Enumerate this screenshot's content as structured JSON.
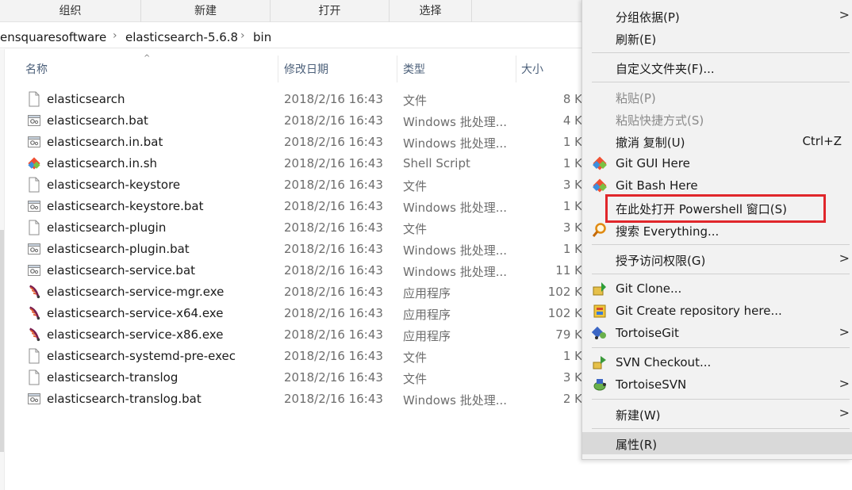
{
  "ribbon": {
    "groups": [
      "组织",
      "新建",
      "打开",
      "选择"
    ]
  },
  "address": {
    "crumbs": [
      "ensquaresoftware",
      "elasticsearch-5.6.8",
      "bin"
    ]
  },
  "columns": {
    "name": "名称",
    "date": "修改日期",
    "type": "类型",
    "size": "大小"
  },
  "files": [
    {
      "name": "elasticsearch",
      "date": "2018/2/16 16:43",
      "type": "文件",
      "size": "8 K",
      "icon": "file-icon"
    },
    {
      "name": "elasticsearch.bat",
      "date": "2018/2/16 16:43",
      "type": "Windows 批处理...",
      "size": "4 K",
      "icon": "batch-file-icon"
    },
    {
      "name": "elasticsearch.in.bat",
      "date": "2018/2/16 16:43",
      "type": "Windows 批处理...",
      "size": "1 K",
      "icon": "batch-file-icon"
    },
    {
      "name": "elasticsearch.in.sh",
      "date": "2018/2/16 16:43",
      "type": "Shell Script",
      "size": "1 K",
      "icon": "git-shell-icon"
    },
    {
      "name": "elasticsearch-keystore",
      "date": "2018/2/16 16:43",
      "type": "文件",
      "size": "3 K",
      "icon": "file-icon"
    },
    {
      "name": "elasticsearch-keystore.bat",
      "date": "2018/2/16 16:43",
      "type": "Windows 批处理...",
      "size": "1 K",
      "icon": "batch-file-icon"
    },
    {
      "name": "elasticsearch-plugin",
      "date": "2018/2/16 16:43",
      "type": "文件",
      "size": "3 K",
      "icon": "file-icon"
    },
    {
      "name": "elasticsearch-plugin.bat",
      "date": "2018/2/16 16:43",
      "type": "Windows 批处理...",
      "size": "1 K",
      "icon": "batch-file-icon"
    },
    {
      "name": "elasticsearch-service.bat",
      "date": "2018/2/16 16:43",
      "type": "Windows 批处理...",
      "size": "11 K",
      "icon": "batch-file-icon"
    },
    {
      "name": "elasticsearch-service-mgr.exe",
      "date": "2018/2/16 16:43",
      "type": "应用程序",
      "size": "102 K",
      "icon": "exe-feather-icon"
    },
    {
      "name": "elasticsearch-service-x64.exe",
      "date": "2018/2/16 16:43",
      "type": "应用程序",
      "size": "102 K",
      "icon": "exe-feather-icon"
    },
    {
      "name": "elasticsearch-service-x86.exe",
      "date": "2018/2/16 16:43",
      "type": "应用程序",
      "size": "79 K",
      "icon": "exe-feather-icon"
    },
    {
      "name": "elasticsearch-systemd-pre-exec",
      "date": "2018/2/16 16:43",
      "type": "文件",
      "size": "1 K",
      "icon": "file-icon"
    },
    {
      "name": "elasticsearch-translog",
      "date": "2018/2/16 16:43",
      "type": "文件",
      "size": "3 K",
      "icon": "file-icon"
    },
    {
      "name": "elasticsearch-translog.bat",
      "date": "2018/2/16 16:43",
      "type": "Windows 批处理...",
      "size": "2 K",
      "icon": "batch-file-icon"
    }
  ],
  "menu": {
    "items": [
      {
        "label": "分组依据(P)",
        "submenu": true
      },
      {
        "label": "刷新(E)"
      },
      {
        "label": "自定义文件夹(F)..."
      },
      {
        "label": "粘贴(P)",
        "disabled": true
      },
      {
        "label": "粘贴快捷方式(S)",
        "disabled": true
      },
      {
        "label": "撤消 复制(U)",
        "accel": "Ctrl+Z"
      },
      {
        "label": "Git GUI Here",
        "icon": "git-icon"
      },
      {
        "label": "Git Bash Here",
        "icon": "git-icon"
      },
      {
        "label": "在此处打开 Powershell 窗口(S)"
      },
      {
        "label": "搜索 Everything...",
        "icon": "everything-search-icon"
      },
      {
        "label": "授予访问权限(G)",
        "submenu": true
      },
      {
        "label": "Git Clone...",
        "icon": "git-clone-icon"
      },
      {
        "label": "Git Create repository here...",
        "icon": "git-create-repo-icon"
      },
      {
        "label": "TortoiseGit",
        "icon": "tortoisegit-icon",
        "submenu": true
      },
      {
        "label": "SVN Checkout...",
        "icon": "svn-checkout-icon"
      },
      {
        "label": "TortoiseSVN",
        "icon": "tortoisesvn-icon",
        "submenu": true
      },
      {
        "label": "新建(W)",
        "submenu": true
      },
      {
        "label": "属性(R)"
      }
    ]
  },
  "colors": {
    "highlight_border": "#e0262b",
    "menu_background": "#f2f2f2",
    "hover": "#d9d9d9"
  }
}
